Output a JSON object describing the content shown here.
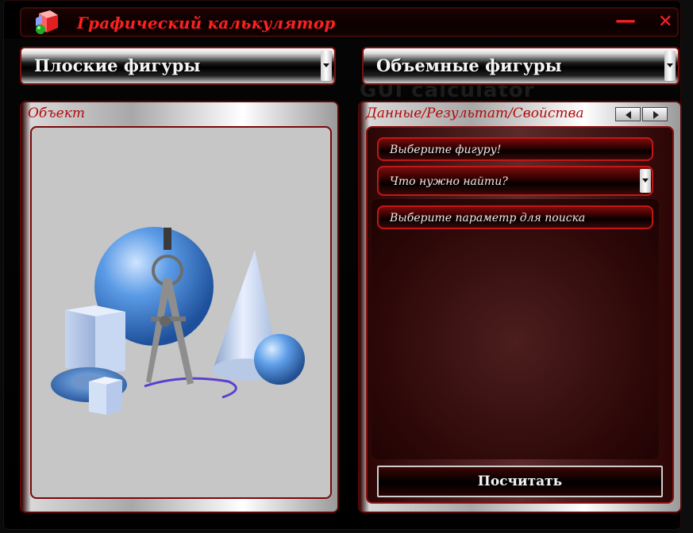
{
  "window": {
    "title": "Графический калькулятор",
    "background_text": "GUI calculator"
  },
  "combos": {
    "flat": {
      "label": "Плоские фигуры"
    },
    "solid": {
      "label": "Объемные фигуры"
    }
  },
  "object_panel": {
    "label": "Объект"
  },
  "data_panel": {
    "label": "Данные/Результат/Свойства",
    "shape_prompt": "Выберите фигуру!",
    "find_prompt": "Что нужно найти?",
    "param_prompt": "Выберите параметр для поиска",
    "calc_button": "Посчитать"
  },
  "colors": {
    "title_red": "#ff2020",
    "accent_border": "#7a1010",
    "label_red": "#b40808"
  },
  "icons": {
    "app": "colored-cubes-icon",
    "minimize": "minimize-icon",
    "close": "close-icon",
    "prev": "arrow-left-icon",
    "next": "arrow-right-icon"
  }
}
